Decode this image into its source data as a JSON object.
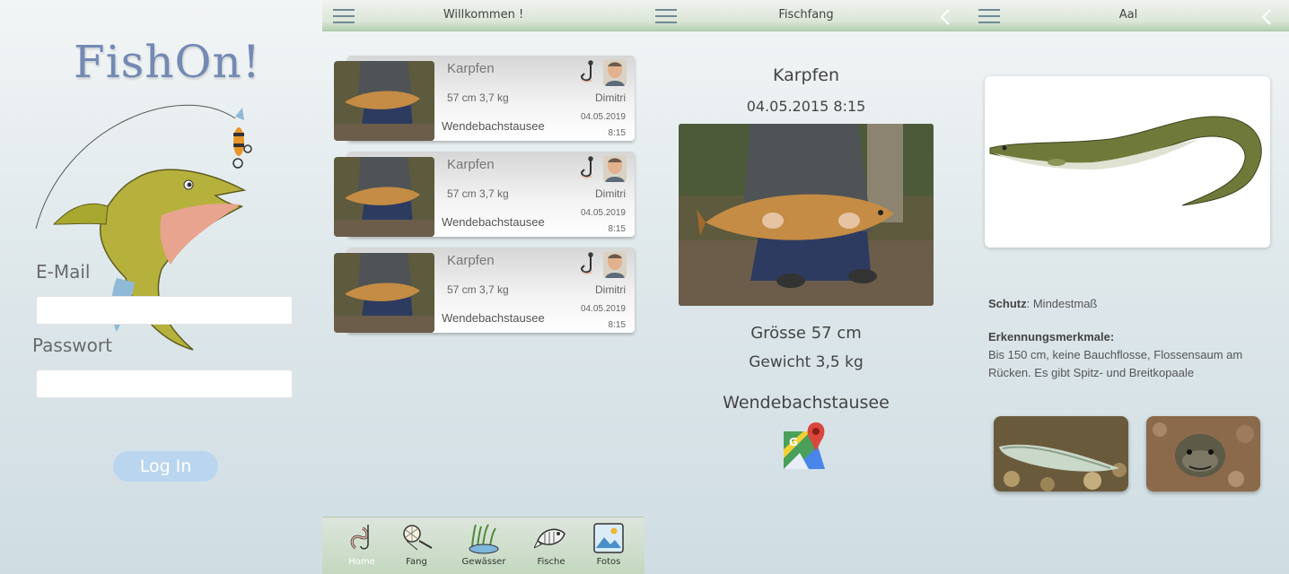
{
  "login": {
    "logo": "FishOn!",
    "email_label": "E-Mail",
    "email_value": "",
    "password_label": "Passwort",
    "password_value": "",
    "login_button": "Log In"
  },
  "home": {
    "title": "Willkommen !",
    "catches": [
      {
        "species": "Karpfen",
        "size": "57 cm  3,7 kg",
        "water": "Wendebachstausee",
        "user": "Dimitri",
        "date": "04.05.2019",
        "time": "8:15"
      },
      {
        "species": "Karpfen",
        "size": "57 cm  3,7 kg",
        "water": "Wendebachstausee",
        "user": "Dimitri",
        "date": "04.05.2019",
        "time": "8:15"
      },
      {
        "species": "Karpfen",
        "size": "57 cm  3,7 kg",
        "water": "Wendebachstausee",
        "user": "Dimitri",
        "date": "04.05.2019",
        "time": "8:15"
      }
    ],
    "nav": [
      {
        "label": "Home",
        "icon": "worm-icon",
        "active": true
      },
      {
        "label": "Fang",
        "icon": "landing-net-icon",
        "active": false
      },
      {
        "label": "Gewässer",
        "icon": "water-plants-icon",
        "active": false
      },
      {
        "label": "Fische",
        "icon": "fish-icon",
        "active": false
      },
      {
        "label": "Fotos",
        "icon": "photo-icon",
        "active": false
      }
    ]
  },
  "catch_detail": {
    "title": "Fischfang",
    "species": "Karpfen",
    "datetime": "04.05.2015 8:15",
    "size": "Grösse 57 cm",
    "weight": "Gewicht 3,5 kg",
    "water": "Wendebachstausee",
    "map_icon": "google-maps-icon"
  },
  "species_detail": {
    "title": "Aal",
    "protection_label": "Schutz",
    "protection_value": ": Mindestmaß",
    "features_label": "Erkennungsmerkmale:",
    "features_text": "Bis 150 cm, keine Bauchflosse, Flossensaum am Rücken. Es gibt Spitz- und Breitkopaale"
  },
  "colors": {
    "accent": "#7489b3",
    "topbar_green": "#b5d1b0",
    "login_button": "#b9d6ee",
    "background": "#dfe8eb"
  }
}
